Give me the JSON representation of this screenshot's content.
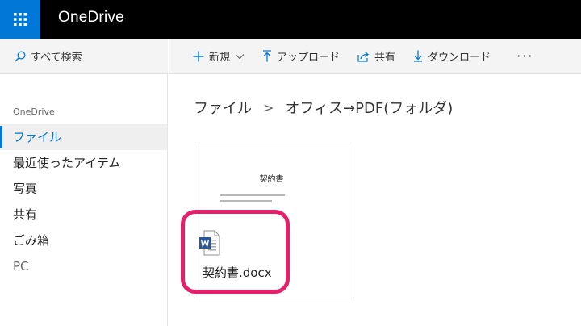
{
  "header": {
    "app_title": "OneDrive",
    "launcher_icon": "waffle-grid-icon",
    "brand_color": "#0078d7"
  },
  "search": {
    "placeholder": "すべて検索",
    "icon": "search-icon"
  },
  "sidebar": {
    "section_label": "OneDrive",
    "items": [
      {
        "label": "ファイル",
        "active": true
      },
      {
        "label": "最近使ったアイテム",
        "active": false
      },
      {
        "label": "写真",
        "active": false
      },
      {
        "label": "共有",
        "active": false
      },
      {
        "label": "ごみ箱",
        "active": false
      },
      {
        "label": "PC",
        "active": false
      }
    ]
  },
  "commandbar": {
    "new_label": "新規",
    "upload_label": "アップロード",
    "share_label": "共有",
    "download_label": "ダウンロード",
    "more_label": "···"
  },
  "breadcrumb": {
    "root": "ファイル",
    "separator": ">",
    "current": "オフィス→PDF(フォルダ)"
  },
  "file": {
    "thumbnail_title": "契約書",
    "name": "契約書.docx",
    "icon": "word-document-icon",
    "highlight_color": "#e4206b"
  }
}
